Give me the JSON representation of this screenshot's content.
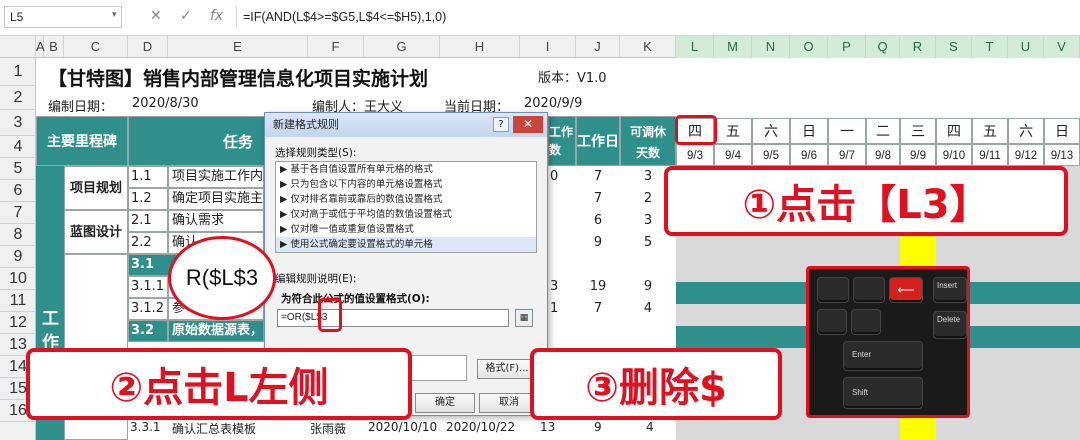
{
  "formula_bar": {
    "name_box": "L5",
    "formula": "=IF(AND(L$4>=$G5,L$4<=$H5),1,0)"
  },
  "columns": [
    "A",
    "B",
    "C",
    "D",
    "E",
    "F",
    "G",
    "H",
    "I",
    "J",
    "K",
    "L",
    "M",
    "N",
    "O",
    "P",
    "Q",
    "R",
    "S",
    "T",
    "U",
    "V"
  ],
  "rows": [
    "1",
    "2",
    "3",
    "4",
    "5",
    "6",
    "7",
    "8",
    "9",
    "10",
    "11",
    "12",
    "13",
    "14",
    "15",
    "16"
  ],
  "sheet": {
    "title": "【甘特图】销售内部管理信息化项目实施计划",
    "version": "版本：V1.0",
    "author_label": "编制日期：",
    "author_date": "2020/8/30",
    "editor_label": "编制人：王大义",
    "current_label": "当前日期：",
    "current_date": "2020/9/9",
    "header_milestone": "主要里程碑",
    "header_task": "任务",
    "header_workdays": "工作日",
    "header_partial": "工作\n数",
    "header_adjustable_1": "可调休",
    "header_adjustable_2": "天数",
    "weekdays": [
      "四",
      "五",
      "六",
      "日",
      "一",
      "二",
      "三",
      "四",
      "五",
      "六",
      "日"
    ],
    "dates": [
      "9/3",
      "9/4",
      "9/5",
      "9/6",
      "9/7",
      "9/8",
      "9/9",
      "9/10",
      "9/11",
      "9/12",
      "9/13"
    ],
    "groups": [
      "项目规划",
      "蓝图设计"
    ],
    "side_label_1": "工",
    "side_label_2": "作",
    "task_rows": [
      {
        "num": "1.1",
        "name": "项目实施工作内容",
        "g": "0",
        "j": "7",
        "k": "3"
      },
      {
        "num": "1.2",
        "name": "确定项目实施主计",
        "g": "",
        "j": "7",
        "k": "2"
      },
      {
        "num": "2.1",
        "name": "确认需求",
        "g": "",
        "j": "6",
        "k": "3"
      },
      {
        "num": "2.2",
        "name": "确认",
        "g": "",
        "j": "9",
        "k": "5"
      },
      {
        "num": "3.1",
        "name": "",
        "g": "",
        "j": "",
        "k": ""
      },
      {
        "num": "3.1.1",
        "name": "",
        "g": "3",
        "j": "19",
        "k": "9"
      },
      {
        "num": "3.1.2",
        "name": "参",
        "g": "1",
        "j": "7",
        "k": "4"
      },
      {
        "num": "3.2",
        "name": "原始数据源表，",
        "g": "",
        "j": "",
        "k": ""
      }
    ],
    "bottom_row": {
      "num": "3.3.1",
      "name": "确认汇总表模板",
      "person": "张雨薇",
      "start": "2020/10/10",
      "end": "2020/10/22",
      "i": "13",
      "j": "9",
      "k": "4"
    }
  },
  "dialog": {
    "title": "新建格式规则",
    "help": "?",
    "close": "✕",
    "select_type_label": "选择规则类型(S):",
    "rule_types": [
      "▶ 基于各自值设置所有单元格的格式",
      "▶ 只为包含以下内容的单元格设置格式",
      "▶ 仅对排名靠前或靠后的数值设置格式",
      "▶ 仅对高于或低于平均值的数值设置格式",
      "▶ 仅对唯一值或重复值设置格式",
      "▶ 使用公式确定要设置格式的单元格"
    ],
    "edit_desc_label": "编辑规则说明(E):",
    "formula_label": "为符合此公式的值设置格式(O):",
    "formula_value": "=OR($L$3",
    "format_button": "格式(F)...",
    "ok_button": "确定",
    "cancel_button": "取消"
  },
  "annotations": {
    "zoom_text": "R($L$3",
    "step1": "①点击【L3】",
    "step2": "②点击L左侧",
    "step3": "③删除$"
  },
  "keyboard": {
    "keys": [
      "Insert",
      "Delete",
      "Enter",
      "Shift"
    ]
  },
  "colors": {
    "teal": "#2f8f8a",
    "annotation_red": "#e01020",
    "highlight_yellow": "#ffff00"
  }
}
